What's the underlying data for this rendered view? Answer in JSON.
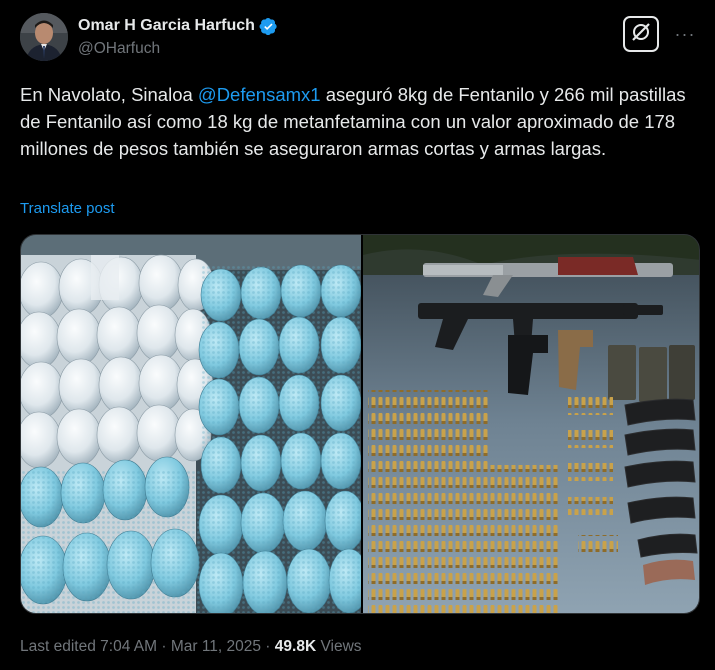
{
  "author": {
    "display_name": "Omar H Garcia Harfuch",
    "handle": "@OHarfuch",
    "verified_icon": "verified-badge-icon",
    "colors": {
      "verified": "#1d9bf0"
    }
  },
  "post": {
    "text_before_mention": "En Navolato, Sinaloa ",
    "mention": "@Defensamx1",
    "text_after_mention": " aseguró 8kg de Fentanilo y 266 mil pastillas de Fentanilo  así como 18 kg de metanfetamina con un valor aproximado de 178 millones de pesos también se aseguraron armas cortas y armas largas.",
    "translate_label": "Translate post"
  },
  "actions": {
    "grok_icon": "grok-icon",
    "more_icon": "more-options-icon",
    "more_label": "···"
  },
  "media": {
    "left_photo": "photo-drugs",
    "right_photo": "photo-weapons"
  },
  "meta": {
    "edited_prefix": "Last edited ",
    "time": "7:04 AM",
    "separator": " · ",
    "date": "Mar 11, 2025",
    "separator2": " · ",
    "views_count": "49.8K",
    "views_label": " Views"
  },
  "colors": {
    "background": "#000000",
    "text": "#e7e9ea",
    "muted": "#71767b",
    "link": "#1d9bf0"
  }
}
